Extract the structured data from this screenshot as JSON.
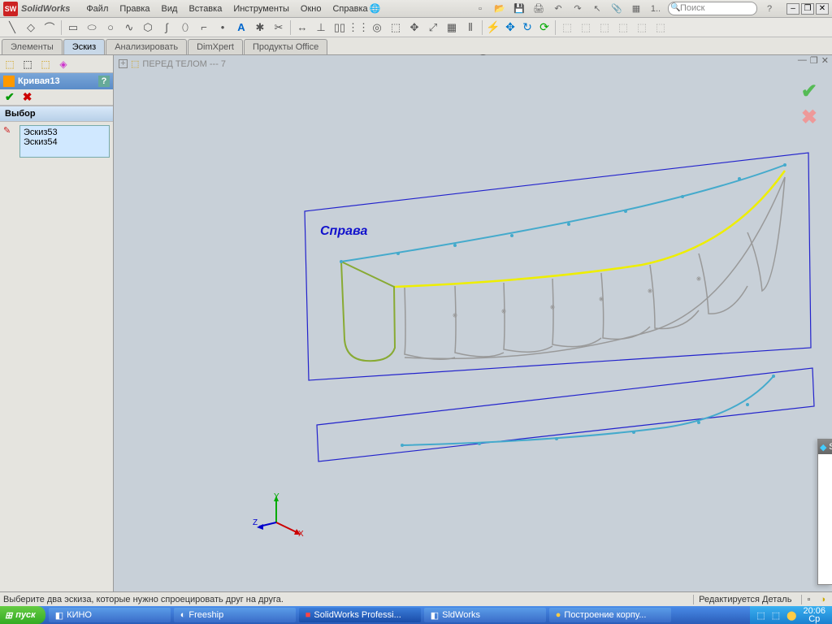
{
  "app": {
    "name": "SolidWorks",
    "logo": "SW"
  },
  "menu": [
    "Файл",
    "Правка",
    "Вид",
    "Вставка",
    "Инструменты",
    "Окно",
    "Справка"
  ],
  "search_placeholder": "Поиск",
  "tabs": [
    "Элементы",
    "Эскиз",
    "Анализировать",
    "DimXpert",
    "Продукты Office"
  ],
  "active_tab": 1,
  "property": {
    "title": "Кривая13",
    "section": "Выбор",
    "items": [
      "Эскиз53",
      "Эскиз54"
    ]
  },
  "tree_item": "ПЕРЕД ТЕЛОМ --- 7",
  "plane_label": "Справа",
  "axis": {
    "x": "X",
    "y": "Y",
    "z": "Z"
  },
  "status": {
    "hint": "Выберите два эскиза, которые нужно спроецировать друг на друга.",
    "mode": "Редактируется Деталь"
  },
  "taskbar": {
    "start": "пуск",
    "items": [
      "КИНО",
      "Freeship",
      "SolidWorks Professi...",
      "SldWorks",
      "Построение корпу..."
    ],
    "active": 2,
    "time": "20:06",
    "day": "Ср"
  },
  "popup_title": "S"
}
